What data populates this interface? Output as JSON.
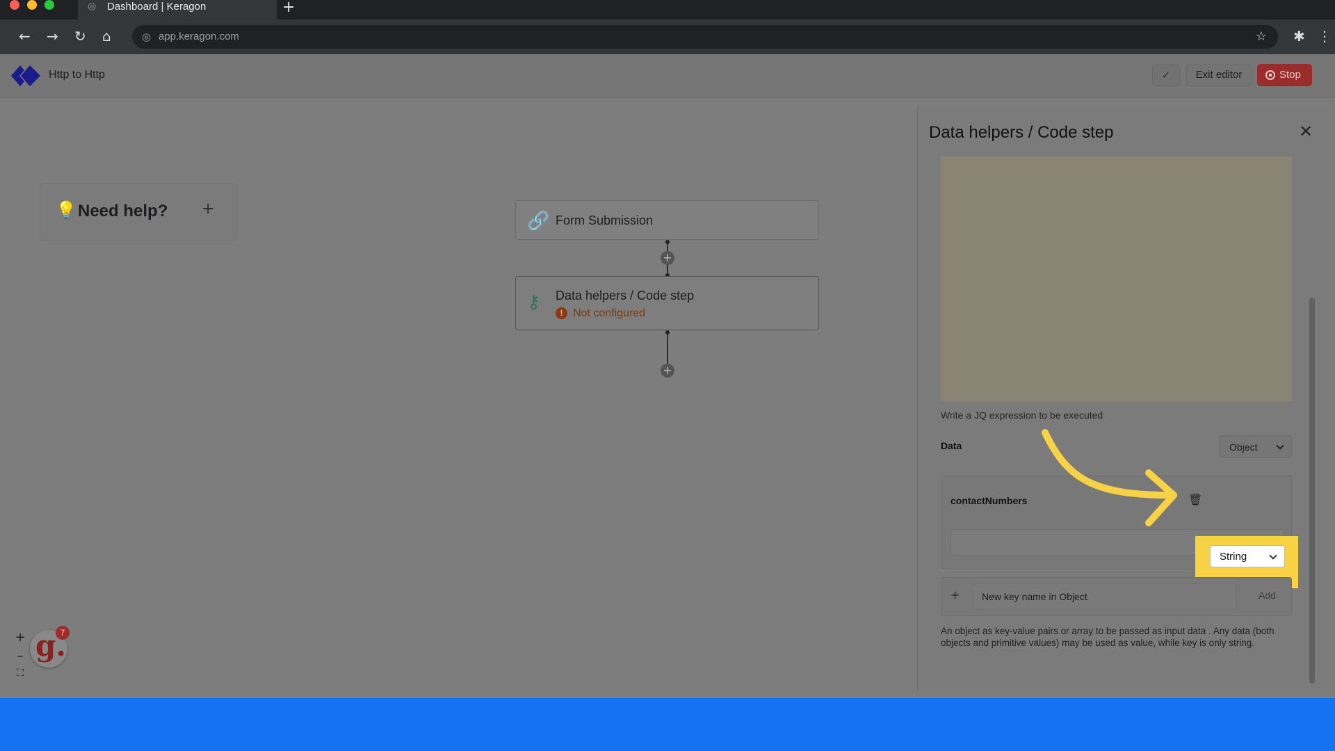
{
  "browser": {
    "tab_title": "Dashboard | Keragon",
    "new_tab": "+",
    "url": "app.keragon.com"
  },
  "header": {
    "flow_name": "Http to Http",
    "check": "✓",
    "exit_label": "Exit editor",
    "stop_label": "Stop"
  },
  "help": {
    "title": "Need help?",
    "expand": "+"
  },
  "flow": {
    "nodes": [
      {
        "title": "Form Submission"
      },
      {
        "title": "Data helpers / Code step",
        "status": "Not configured"
      }
    ],
    "add": "+"
  },
  "zoom": {
    "in": "+",
    "out": "–",
    "fit": "⛶"
  },
  "assistant": {
    "letter": "g.",
    "badge": "7"
  },
  "panel": {
    "title": "Data helpers / Code step",
    "code_help": "Write a JQ expression to be executed",
    "data_label": "Data",
    "data_type": "Object",
    "items": [
      {
        "key": "contactNumbers",
        "type": "String"
      }
    ],
    "new_key_placeholder": "New key name in Object",
    "add_label": "Add",
    "description": "An object as key-value pairs or array to be passed as input data . Any data (both objects and primitive values) may be used as value, while key is only string."
  },
  "colors": {
    "overlay": "#7d7d7d",
    "stop": "#9b2c2c",
    "highlight": "#f7d245",
    "bottom_bar": "#1572f0"
  }
}
